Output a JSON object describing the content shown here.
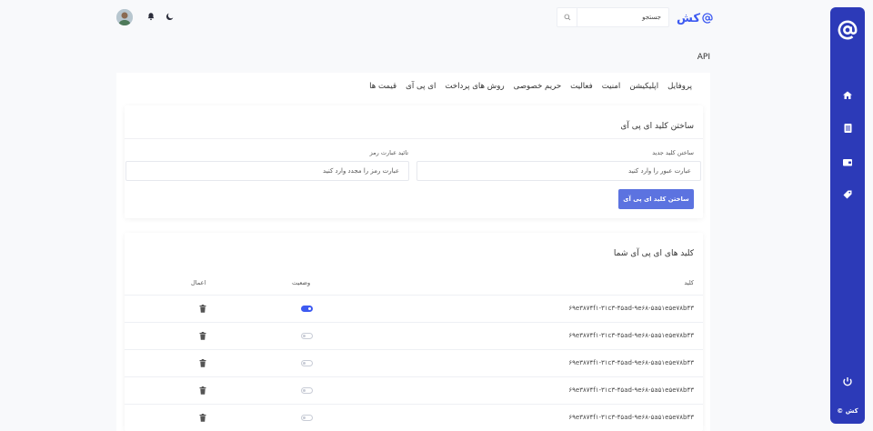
{
  "brand": {
    "name": "کش",
    "icon": "at-sign-icon"
  },
  "search": {
    "placeholder": "جستجو",
    "icon": "search-icon"
  },
  "header_icons": [
    "moon-icon",
    "bell-icon",
    "user-avatar"
  ],
  "page_title": "API",
  "tabs": [
    {
      "label": "پروفایل"
    },
    {
      "label": "اپلیکیشن"
    },
    {
      "label": "امنیت"
    },
    {
      "label": "فعالیت"
    },
    {
      "label": "حریم خصوصی"
    },
    {
      "label": "روش های پرداخت"
    },
    {
      "label": "ای پی آی"
    },
    {
      "label": "قیمت ها"
    }
  ],
  "create_panel": {
    "title": "ساختن کلید ای پی آی",
    "new_key_label": "ساختن کلید جدید",
    "new_key_placeholder": "عبارت عبور را وارد کنید",
    "confirm_label": "تائید عبارت رمز",
    "confirm_placeholder": "عبارت رمز را مجدد وارد کنید",
    "submit_label": "ساختن کلید ای پی آی"
  },
  "keys_panel": {
    "title": "کلید های ای پی آی شما",
    "columns": {
      "key": "کلید",
      "status": "وضعیت",
      "actions": "اعمال"
    },
    "rows": [
      {
        "key": "۶۹e۳۸۷۴f۱-۳۱c۳-۴۵ad-۹e۶۸-۵a۵۱e۵e۷۸b۴۳",
        "enabled": true
      },
      {
        "key": "۶۹e۳۸۷۴f۱-۳۱c۳-۴۵ad-۹e۶۸-۵a۵۱e۵e۷۸b۴۳",
        "enabled": false
      },
      {
        "key": "۶۹e۳۸۷۴f۱-۳۱c۳-۴۵ad-۹e۶۸-۵a۵۱e۵e۷۸b۴۳",
        "enabled": false
      },
      {
        "key": "۶۹e۳۸۷۴f۱-۳۱c۳-۴۵ad-۹e۶۸-۵a۵۱e۵e۷۸b۴۳",
        "enabled": false
      },
      {
        "key": "۶۹e۳۸۷۴f۱-۳۱c۳-۴۵ad-۹e۶۸-۵a۵۱e۵e۷۸b۴۳",
        "enabled": false
      }
    ]
  },
  "sidebar": {
    "items": [
      {
        "icon": "home-icon"
      },
      {
        "icon": "document-icon"
      },
      {
        "icon": "wallet-icon"
      },
      {
        "icon": "tag-icon"
      }
    ],
    "power_icon": "power-icon",
    "footer": "© کش"
  },
  "colors": {
    "primary": "#2c3ab8",
    "accent": "#3d5af1",
    "button": "#5c73e0",
    "background": "#f8f9fb"
  }
}
